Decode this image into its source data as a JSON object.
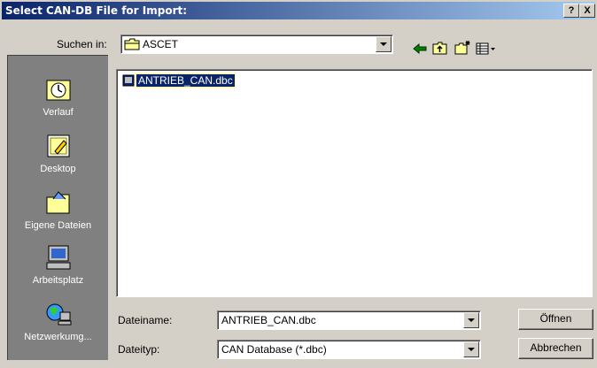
{
  "window": {
    "title": "Select CAN-DB File for Import:",
    "help_label": "?",
    "close_label": "X"
  },
  "lookin": {
    "label": "Suchen in:",
    "value": "ASCET"
  },
  "places": [
    {
      "label": "Verlauf"
    },
    {
      "label": "Desktop"
    },
    {
      "label": "Eigene Dateien"
    },
    {
      "label": "Arbeitsplatz"
    },
    {
      "label": "Netzwerkumg..."
    }
  ],
  "files": [
    {
      "name": "ANTRIEB_CAN.dbc"
    }
  ],
  "filename": {
    "label": "Dateiname:",
    "value": "ANTRIEB_CAN.dbc"
  },
  "filetype": {
    "label": "Dateityp:",
    "value": "CAN Database (*.dbc)"
  },
  "buttons": {
    "open": "Öffnen",
    "cancel": "Abbrechen"
  },
  "icons": [
    "back-arrow-icon",
    "up-folder-icon",
    "new-folder-icon",
    "view-menu-icon"
  ]
}
